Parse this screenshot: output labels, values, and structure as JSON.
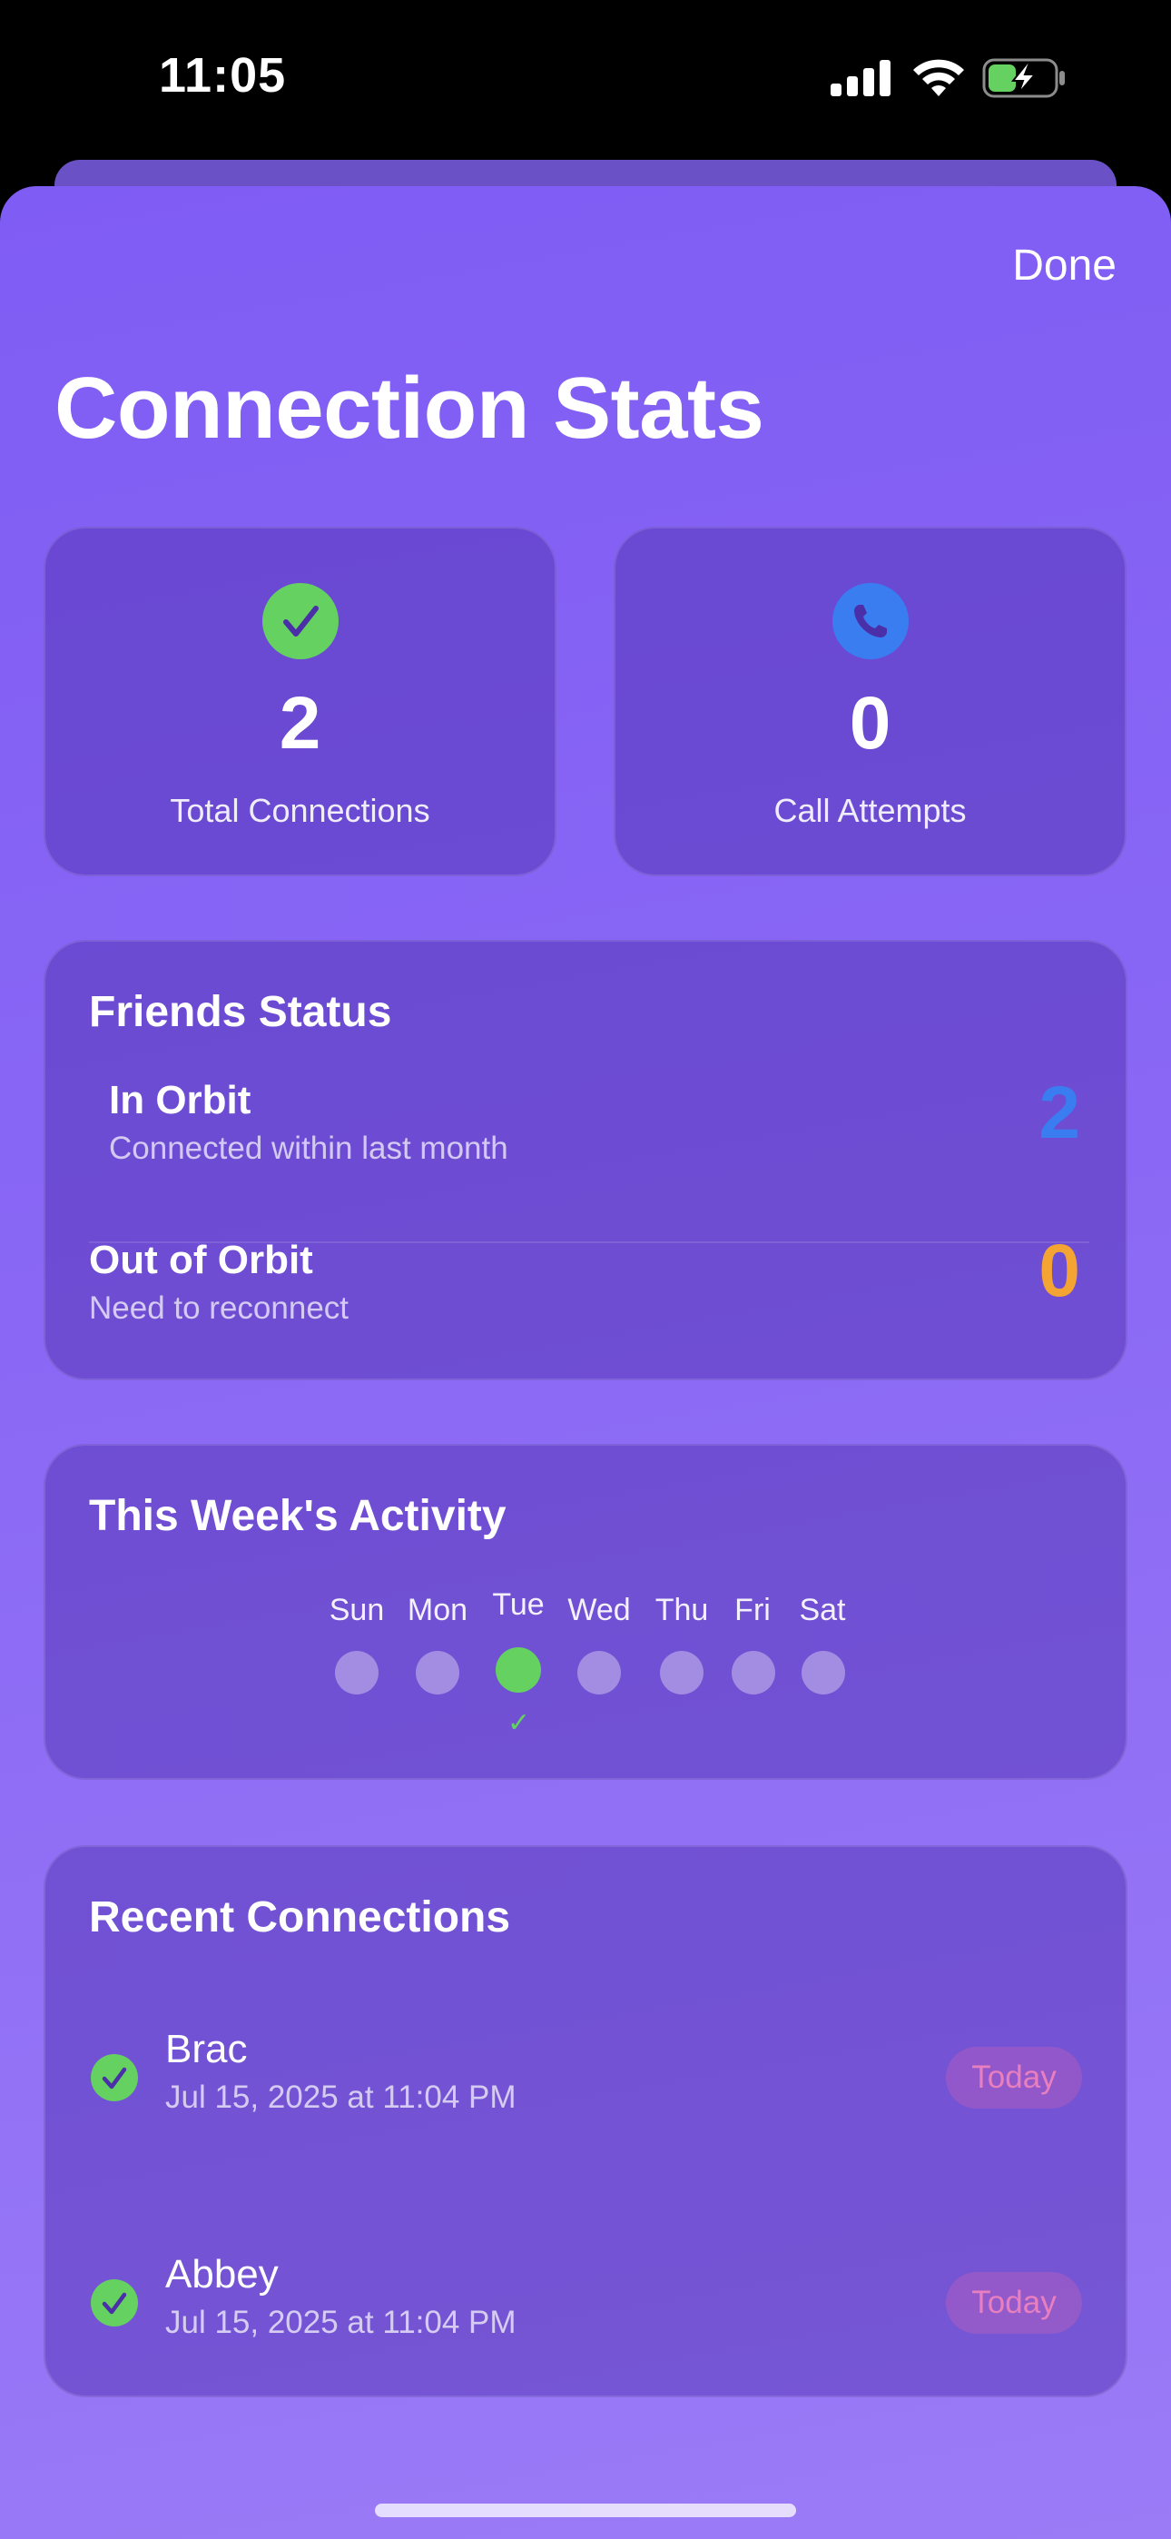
{
  "status_bar": {
    "time": "11:05"
  },
  "header": {
    "done_label": "Done",
    "title": "Connection Stats"
  },
  "stats": {
    "total_connections": {
      "value": "2",
      "label": "Total Connections",
      "icon": "checkmark-circle-icon",
      "color": "#64d160"
    },
    "call_attempts": {
      "value": "0",
      "label": "Call Attempts",
      "icon": "phone-icon",
      "color": "#3a7df0"
    }
  },
  "friends_status": {
    "title": "Friends Status",
    "in_orbit": {
      "name": "In Orbit",
      "subtitle": "Connected within last month",
      "count": "2",
      "color": "#3a7df0"
    },
    "out_of_orbit": {
      "name": "Out of Orbit",
      "subtitle": "Need to reconnect",
      "count": "0",
      "color": "#f4a432"
    }
  },
  "week_activity": {
    "title": "This Week's Activity",
    "days": [
      {
        "label": "Sun",
        "active": false
      },
      {
        "label": "Mon",
        "active": false
      },
      {
        "label": "Tue",
        "active": true
      },
      {
        "label": "Wed",
        "active": false
      },
      {
        "label": "Thu",
        "active": false
      },
      {
        "label": "Fri",
        "active": false
      },
      {
        "label": "Sat",
        "active": false
      }
    ],
    "active_mark": "✓"
  },
  "recent_connections": {
    "title": "Recent Connections",
    "items": [
      {
        "name": "Brac",
        "date": "Jul 15, 2025 at 11:04 PM",
        "badge": "Today"
      },
      {
        "name": "Abbey",
        "date": "Jul 15, 2025 at 11:04 PM",
        "badge": "Today"
      }
    ]
  },
  "colors": {
    "accent_green": "#64d160",
    "accent_blue": "#3a7df0",
    "accent_orange": "#f4a432",
    "badge_pink": "#e87fbf"
  }
}
